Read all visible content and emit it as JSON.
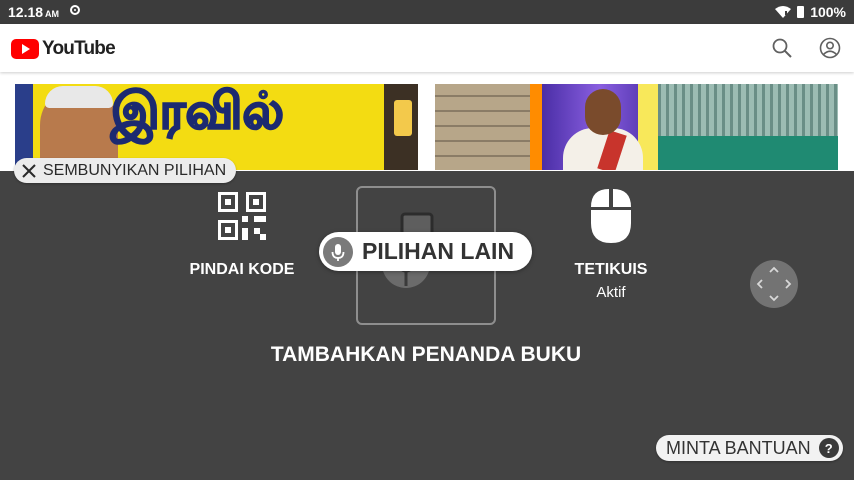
{
  "status_bar": {
    "time": "12.18",
    "ampm": "AM",
    "battery": "100%"
  },
  "header": {
    "logo_text": "YouTube",
    "brand_color": "#ff0000"
  },
  "thumbnails": [
    {
      "title_text": "இரவில்"
    },
    {
      "title_text": ""
    }
  ],
  "overlay": {
    "hide_label": "SEMBUNYIKAN PILIHAN",
    "scan_label": "PINDAI KODE",
    "more_label": "PILIHAN LAIN",
    "mouse_label": "TETIKUIS",
    "mouse_status": "Aktif",
    "bookmark_label": "TAMBAHKAN PENANDA BUKU",
    "help_label": "MINTA BANTUAN",
    "help_icon_glyph": "?",
    "background_color": "#434343"
  },
  "icons": [
    "search-icon",
    "account-icon",
    "close-icon",
    "qr-code-icon",
    "mouse-icon",
    "bookmark-icon",
    "microphone-icon",
    "move-arrows-icon",
    "help-icon",
    "wifi-icon",
    "battery-icon"
  ]
}
